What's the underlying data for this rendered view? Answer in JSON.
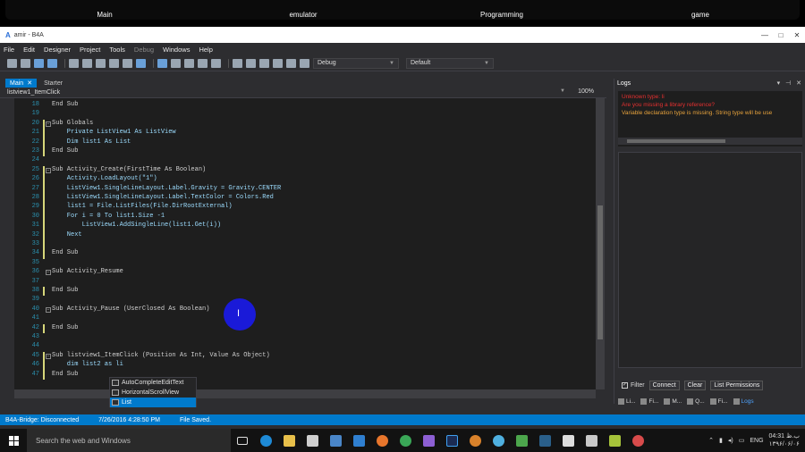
{
  "top_tabs": [
    "Main",
    "emulator",
    "Programming",
    "game"
  ],
  "window": {
    "title": "amir - B4A",
    "minimize": "—",
    "maximize": "□",
    "close": "✕"
  },
  "menu": [
    "File",
    "Edit",
    "Designer",
    "Project",
    "Tools",
    "Debug",
    "Windows",
    "Help"
  ],
  "toolbar": {
    "config_select": "Debug",
    "target_select": "Default"
  },
  "editor": {
    "tabs": [
      {
        "label": "Main",
        "close": "✕",
        "active": true
      },
      {
        "label": "Starter",
        "active": false
      }
    ],
    "breadcrumb": "listview1_ItemClick",
    "zoom": "100%"
  },
  "code_lines": [
    {
      "n": "18",
      "text": "End Sub",
      "cls": "kw"
    },
    {
      "n": "19",
      "text": "",
      "cls": "kw"
    },
    {
      "n": "20",
      "text": "Sub Globals",
      "cls": "kw"
    },
    {
      "n": "21",
      "text": "    Private ListView1 As ListView",
      "cls": "id"
    },
    {
      "n": "22",
      "text": "    Dim list1 As List",
      "cls": "id"
    },
    {
      "n": "23",
      "text": "End Sub",
      "cls": "kw"
    },
    {
      "n": "24",
      "text": "",
      "cls": "kw"
    },
    {
      "n": "25",
      "text": "Sub Activity_Create(FirstTime As Boolean)",
      "cls": "kw"
    },
    {
      "n": "26",
      "text": "    Activity.LoadLayout(\"1\")",
      "cls": "id"
    },
    {
      "n": "27",
      "text": "    ListView1.SingleLineLayout.Label.Gravity = Gravity.CENTER",
      "cls": "id"
    },
    {
      "n": "28",
      "text": "    ListView1.SingleLineLayout.Label.TextColor = Colors.Red",
      "cls": "id"
    },
    {
      "n": "29",
      "text": "    list1 = File.ListFiles(File.DirRootExternal)",
      "cls": "id"
    },
    {
      "n": "30",
      "text": "    For i = 0 To list1.Size -1",
      "cls": "id"
    },
    {
      "n": "31",
      "text": "        ListView1.AddSingleLine(list1.Get(i))",
      "cls": "id"
    },
    {
      "n": "32",
      "text": "    Next",
      "cls": "id"
    },
    {
      "n": "33",
      "text": "",
      "cls": "kw"
    },
    {
      "n": "34",
      "text": "End Sub",
      "cls": "kw"
    },
    {
      "n": "35",
      "text": "",
      "cls": "kw"
    },
    {
      "n": "36",
      "text": "Sub Activity_Resume",
      "cls": "kw"
    },
    {
      "n": "37",
      "text": "",
      "cls": "kw"
    },
    {
      "n": "38",
      "text": "End Sub",
      "cls": "kw"
    },
    {
      "n": "39",
      "text": "",
      "cls": "kw"
    },
    {
      "n": "40",
      "text": "Sub Activity_Pause (UserClosed As Boolean)",
      "cls": "kw"
    },
    {
      "n": "41",
      "text": "",
      "cls": "kw"
    },
    {
      "n": "42",
      "text": "End Sub",
      "cls": "kw"
    },
    {
      "n": "43",
      "text": "",
      "cls": "kw"
    },
    {
      "n": "44",
      "text": "",
      "cls": "kw"
    },
    {
      "n": "45",
      "text": "Sub listview1_ItemClick (Position As Int, Value As Object)",
      "cls": "kw"
    },
    {
      "n": "46",
      "text": "    dim list2 as li",
      "cls": "id"
    },
    {
      "n": "47",
      "text": "End Sub",
      "cls": "kw"
    }
  ],
  "autocomplete": [
    "AutoCompleteEditText",
    "HorizontalScrollView",
    "List"
  ],
  "logs": {
    "title": "Logs",
    "lines": [
      {
        "text": "Unknown type: li",
        "color": "red"
      },
      {
        "text": "Are you missing a library reference?",
        "color": "red"
      },
      {
        "text": "Variable declaration type is missing. String type will be use",
        "color": "orange"
      }
    ],
    "filter_label": "Filter",
    "buttons": [
      "Connect",
      "Clear",
      "List Permissions"
    ],
    "bottom_tabs": [
      "Li...",
      "Fi...",
      "M...",
      "Q...",
      "Fi...",
      "Logs"
    ]
  },
  "statusbar": [
    "B4A-Bridge: Disconnected",
    "7/26/2016 4:28:50 PM",
    "File Saved."
  ],
  "taskbar": {
    "search_placeholder": "Search the web and Windows",
    "lang": "ENG",
    "time": "04:31 ب.ظ",
    "date": "۱۳۹۶/۰۶/۰۶"
  }
}
